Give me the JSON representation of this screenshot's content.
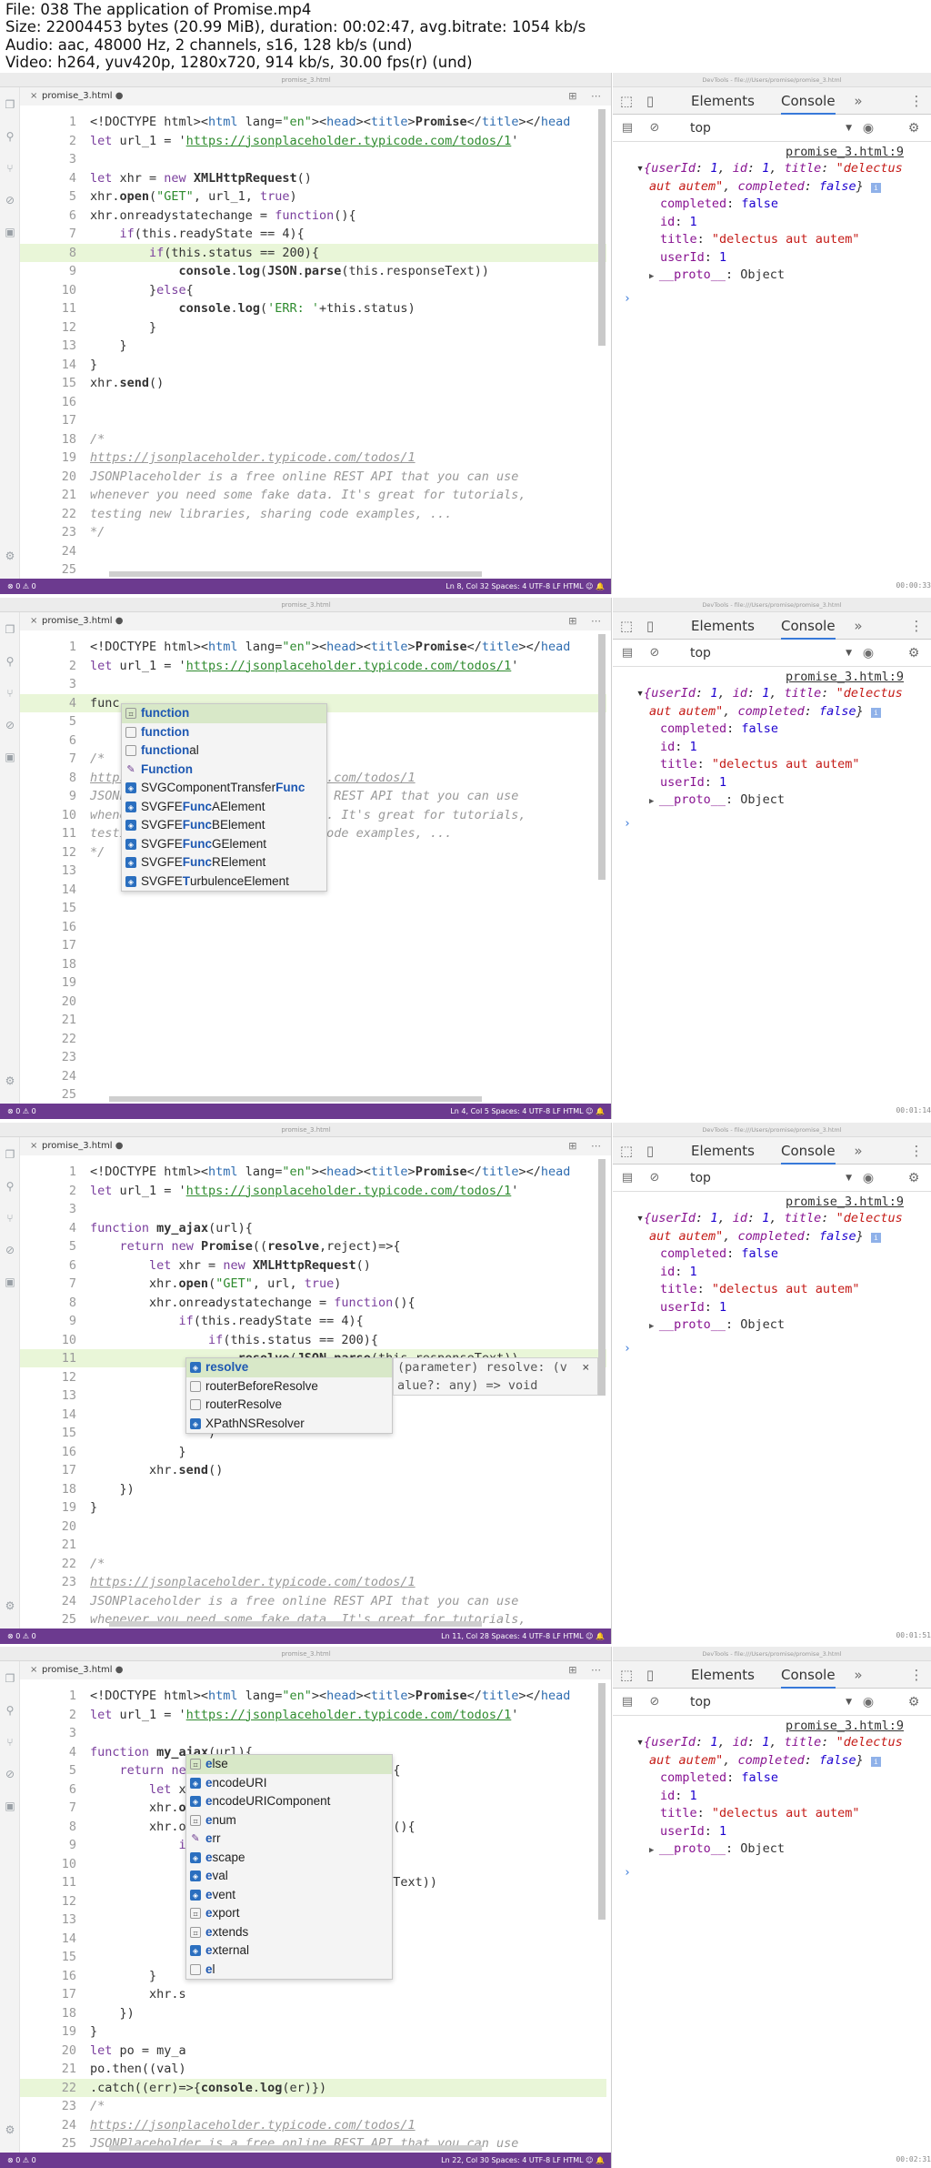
{
  "header": {
    "file": "File: 038 The application of Promise.mp4",
    "size": "Size: 22004453 bytes (20.99 MiB), duration: 00:02:47, avg.bitrate: 1054 kb/s",
    "audio": "Audio: aac, 48000 Hz, 2 channels, s16, 128 kb/s (und)",
    "video": "Video: h264, yuv420p, 1280x720, 914 kb/s, 30.00 fps(r) (und)"
  },
  "editor": {
    "tab_name": "promise_3.html",
    "titlebar_text": "promise_3.html"
  },
  "devtools": {
    "titlebar_text": "DevTools - file:///Users/promise/promise_3.html",
    "tab_elements": "Elements",
    "tab_console": "Console",
    "tab_more": "»",
    "context": "top",
    "source_link": "promise_3.html:9",
    "log_lines": [
      {
        "pre": "▾",
        "text": "{userId: 1, id: 1, title: \"delectus"
      },
      {
        "pre": "",
        "text": "aut autem\", completed: false}"
      },
      {
        "pre": "",
        "key": "completed",
        "value": "false"
      },
      {
        "pre": "",
        "key": "id",
        "value": "1"
      },
      {
        "pre": "",
        "key": "title",
        "value": "\"delectus aut autem\""
      },
      {
        "pre": "",
        "key": "userId",
        "value": "1"
      },
      {
        "pre": "▸",
        "key": "__proto__",
        "value": "Object"
      }
    ],
    "prompt": "›"
  },
  "frames": [
    {
      "timestamp": "00:00:33",
      "status_left": "⊗ 0  ⚠ 0",
      "status_right": "Ln 8, Col 32   Spaces: 4   UTF-8   LF   HTML   ☺  🔔",
      "highlight": 8,
      "lines": [
        {
          "n": "1",
          "t": "<!DOCTYPE html><html lang=\"en\"><head><title>Promise</title></head"
        },
        {
          "n": "2",
          "t": "let url_1 = 'https://jsonplaceholder.typicode.com/todos/1'"
        },
        {
          "n": "3",
          "t": ""
        },
        {
          "n": "4",
          "t": "let xhr = new XMLHttpRequest()"
        },
        {
          "n": "5",
          "t": "xhr.open(\"GET\", url_1, true)"
        },
        {
          "n": "6",
          "t": "xhr.onreadystatechange = function(){"
        },
        {
          "n": "7",
          "t": "    if(this.readyState == 4){"
        },
        {
          "n": "8",
          "t": "        if(this.status == 200){"
        },
        {
          "n": "9",
          "t": "            console.log(JSON.parse(this.responseText))"
        },
        {
          "n": "10",
          "t": "        }else{"
        },
        {
          "n": "11",
          "t": "            console.log('ERR: '+this.status)"
        },
        {
          "n": "12",
          "t": "        }"
        },
        {
          "n": "13",
          "t": "    }"
        },
        {
          "n": "14",
          "t": "}"
        },
        {
          "n": "15",
          "t": "xhr.send()"
        },
        {
          "n": "16",
          "t": ""
        },
        {
          "n": "17",
          "t": ""
        },
        {
          "n": "18",
          "t": "/*"
        },
        {
          "n": "19",
          "t": "https://jsonplaceholder.typicode.com/todos/1"
        },
        {
          "n": "20",
          "t": "JSONPlaceholder is a free online REST API that you can use"
        },
        {
          "n": "21",
          "t": "whenever you need some fake data. It's great for tutorials,"
        },
        {
          "n": "22",
          "t": "testing new libraries, sharing code examples, ..."
        },
        {
          "n": "23",
          "t": "*/"
        },
        {
          "n": "24",
          "t": ""
        },
        {
          "n": "25",
          "t": ""
        }
      ]
    },
    {
      "timestamp": "00:01:14",
      "status_left": "⊗ 0  ⚠ 0",
      "status_right": "Ln 4, Col 5   Spaces: 4   UTF-8   LF   HTML   ☺  🔔",
      "highlight": 4,
      "lines": [
        {
          "n": "1",
          "t": "<!DOCTYPE html><html lang=\"en\"><head><title>Promise</title></head"
        },
        {
          "n": "2",
          "t": "let url_1 = 'https://jsonplaceholder.typicode.com/todos/1'"
        },
        {
          "n": "3",
          "t": ""
        },
        {
          "n": "4",
          "t": "func"
        },
        {
          "n": "5",
          "t": ""
        },
        {
          "n": "6",
          "t": ""
        },
        {
          "n": "7",
          "t": "/*"
        },
        {
          "n": "8",
          "t": "https://jsonplaceholder.typicode.com/todos/1"
        },
        {
          "n": "9",
          "t": "JSONPlaceholder is a free online REST API that you can use"
        },
        {
          "n": "10",
          "t": "whenever you need some fake data. It's great for tutorials,"
        },
        {
          "n": "11",
          "t": "testing new libraries, sharing code examples, ..."
        },
        {
          "n": "12",
          "t": "*/"
        },
        {
          "n": "13",
          "t": ""
        },
        {
          "n": "14",
          "t": ""
        },
        {
          "n": "15",
          "t": ""
        },
        {
          "n": "16",
          "t": ""
        },
        {
          "n": "17",
          "t": ""
        },
        {
          "n": "18",
          "t": ""
        },
        {
          "n": "19",
          "t": ""
        },
        {
          "n": "20",
          "t": ""
        },
        {
          "n": "21",
          "t": ""
        },
        {
          "n": "22",
          "t": ""
        },
        {
          "n": "23",
          "t": ""
        },
        {
          "n": "24",
          "t": ""
        },
        {
          "n": "25",
          "t": ""
        }
      ],
      "autocomplete": [
        {
          "icon": "snippet",
          "pre": "",
          "m": "function",
          "post": "",
          "sel": true
        },
        {
          "icon": "box",
          "pre": "",
          "m": "function",
          "post": "",
          "sel": false
        },
        {
          "icon": "box",
          "pre": "",
          "m": "function",
          "post": "al",
          "sel": false
        },
        {
          "icon": "wrench",
          "pre": "",
          "m": "Function",
          "post": "",
          "sel": false
        },
        {
          "icon": "struct",
          "pre": "SVGComponentTransfer",
          "m": "Func",
          "post": "",
          "sel": false
        },
        {
          "icon": "struct",
          "pre": "SVGFE",
          "m": "Func",
          "post": "AElement",
          "sel": false
        },
        {
          "icon": "struct",
          "pre": "SVGFE",
          "m": "Func",
          "post": "BElement",
          "sel": false
        },
        {
          "icon": "struct",
          "pre": "SVGFE",
          "m": "Func",
          "post": "GElement",
          "sel": false
        },
        {
          "icon": "struct",
          "pre": "SVGFE",
          "m": "Func",
          "post": "RElement",
          "sel": false
        },
        {
          "icon": "struct",
          "pre": "SVGFE",
          "m": "T",
          "post": "urbulenceElement",
          "sel": false
        }
      ]
    },
    {
      "timestamp": "00:01:51",
      "status_left": "⊗ 0  ⚠ 0",
      "status_right": "Ln 11, Col 28   Spaces: 4   UTF-8   LF   HTML   ☺  🔔",
      "highlight": 11,
      "lines": [
        {
          "n": "1",
          "t": "<!DOCTYPE html><html lang=\"en\"><head><title>Promise</title></head"
        },
        {
          "n": "2",
          "t": "let url_1 = 'https://jsonplaceholder.typicode.com/todos/1'"
        },
        {
          "n": "3",
          "t": ""
        },
        {
          "n": "4",
          "t": "function my_ajax(url){"
        },
        {
          "n": "5",
          "t": "    return new Promise((resolve,reject)=>{"
        },
        {
          "n": "6",
          "t": "        let xhr = new XMLHttpRequest()"
        },
        {
          "n": "7",
          "t": "        xhr.open(\"GET\", url, true)"
        },
        {
          "n": "8",
          "t": "        xhr.onreadystatechange = function(){"
        },
        {
          "n": "9",
          "t": "            if(this.readyState == 4){"
        },
        {
          "n": "10",
          "t": "                if(this.status == 200){"
        },
        {
          "n": "11",
          "t": "                    resolve(JSON.parse(this.responseText))"
        },
        {
          "n": "12",
          "t": ""
        },
        {
          "n": "13",
          "t": ""
        },
        {
          "n": "14",
          "t": ""
        },
        {
          "n": "15",
          "t": "                )"
        },
        {
          "n": "16",
          "t": "            }"
        },
        {
          "n": "17",
          "t": "        xhr.send()"
        },
        {
          "n": "18",
          "t": "    })"
        },
        {
          "n": "19",
          "t": "}"
        },
        {
          "n": "20",
          "t": ""
        },
        {
          "n": "21",
          "t": ""
        },
        {
          "n": "22",
          "t": "/*"
        },
        {
          "n": "23",
          "t": "https://jsonplaceholder.typicode.com/todos/1"
        },
        {
          "n": "24",
          "t": "JSONPlaceholder is a free online REST API that you can use"
        },
        {
          "n": "25",
          "t": "whenever you need some fake data. It's great for tutorials,"
        }
      ],
      "autocomplete": [
        {
          "icon": "struct",
          "pre": "",
          "m": "resolve",
          "post": "",
          "sel": true
        },
        {
          "icon": "box",
          "pre": "router",
          "m": "",
          "post": "BeforeResolve",
          "sel": false
        },
        {
          "icon": "box",
          "pre": "router",
          "m": "",
          "post": "Resolve",
          "sel": false
        },
        {
          "icon": "struct",
          "pre": "XPathNS",
          "m": "",
          "post": "Resolver",
          "sel": false
        }
      ],
      "doc": "(parameter) resolve: (v  ×\nalue?: any) => void"
    },
    {
      "timestamp": "00:02:31",
      "status_left": "⊗ 0  ⚠ 0",
      "status_right": "Ln 22, Col 30   Spaces: 4   UTF-8   LF   HTML   ☺  🔔",
      "highlight": 22,
      "lines": [
        {
          "n": "1",
          "t": "<!DOCTYPE html><html lang=\"en\"><head><title>Promise</title></head"
        },
        {
          "n": "2",
          "t": "let url_1 = 'https://jsonplaceholder.typicode.com/todos/1'"
        },
        {
          "n": "3",
          "t": ""
        },
        {
          "n": "4",
          "t": "function my_ajax(url){"
        },
        {
          "n": "5",
          "t": "    return new Promise((resolve,reject)=>{"
        },
        {
          "n": "6",
          "t": "        let xhr = new XMLHttpRequest()"
        },
        {
          "n": "7",
          "t": "        xhr.open(\"GET\", url, true)"
        },
        {
          "n": "8",
          "t": "        xhr.onreadystatechange = function(){"
        },
        {
          "n": "9",
          "t": "            if(this.readyState == 4){"
        },
        {
          "n": "10",
          "t": ""
        },
        {
          "n": "11",
          "t": "                             his.responseText))"
        },
        {
          "n": "12",
          "t": ""
        },
        {
          "n": "13",
          "t": "                             status)"
        },
        {
          "n": "14",
          "t": ""
        },
        {
          "n": "15",
          "t": ""
        },
        {
          "n": "16",
          "t": "        }"
        },
        {
          "n": "17",
          "t": "        xhr.s"
        },
        {
          "n": "18",
          "t": "    })"
        },
        {
          "n": "19",
          "t": "}"
        },
        {
          "n": "20",
          "t": "let po = my_a"
        },
        {
          "n": "21",
          "t": "po.then((val)"
        },
        {
          "n": "22",
          "t": ".catch((err)=>{console.log(er)})"
        },
        {
          "n": "23",
          "t": "/*"
        },
        {
          "n": "24",
          "t": "https://jsonplaceholder.typicode.com/todos/1"
        },
        {
          "n": "25",
          "t": "JSONPlaceholder is a free online REST API that you can use"
        }
      ],
      "autocomplete": [
        {
          "icon": "snippet",
          "pre": "",
          "m": "e",
          "post": "lse",
          "sel": true
        },
        {
          "icon": "struct",
          "pre": "",
          "m": "e",
          "post": "ncodeURI",
          "sel": false
        },
        {
          "icon": "struct",
          "pre": "",
          "m": "e",
          "post": "ncodeURIComponent",
          "sel": false
        },
        {
          "icon": "snippet",
          "pre": "",
          "m": "e",
          "post": "num",
          "sel": false
        },
        {
          "icon": "wrench",
          "pre": "",
          "m": "e",
          "post": "rr",
          "sel": false
        },
        {
          "icon": "struct",
          "pre": "",
          "m": "e",
          "post": "scape",
          "sel": false
        },
        {
          "icon": "struct",
          "pre": "",
          "m": "e",
          "post": "val",
          "sel": false
        },
        {
          "icon": "struct",
          "pre": "",
          "m": "e",
          "post": "vent",
          "sel": false
        },
        {
          "icon": "snippet",
          "pre": "",
          "m": "e",
          "post": "xport",
          "sel": false
        },
        {
          "icon": "snippet",
          "pre": "",
          "m": "e",
          "post": "xtends",
          "sel": false
        },
        {
          "icon": "struct",
          "pre": "",
          "m": "e",
          "post": "xternal",
          "sel": false
        },
        {
          "icon": "box",
          "pre": "",
          "m": "e",
          "post": "l",
          "sel": false
        }
      ]
    }
  ]
}
